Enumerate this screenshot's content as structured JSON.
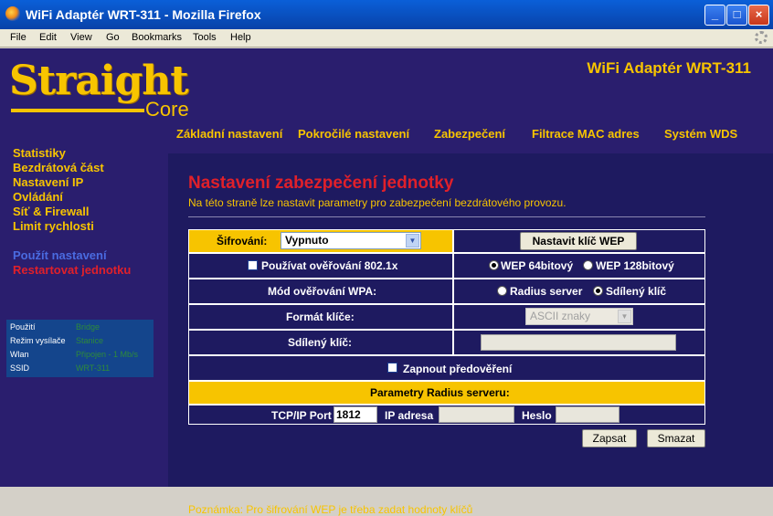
{
  "window": {
    "title": "WiFi Adaptér WRT-311 - Mozilla Firefox"
  },
  "menu": {
    "items": [
      "File",
      "Edit",
      "View",
      "Go",
      "Bookmarks",
      "Tools",
      "Help"
    ]
  },
  "logo": {
    "main": "Straight",
    "sub": "Core"
  },
  "product_name": "WiFi Adaptér WRT-311",
  "top_nav": [
    "Základní nastavení",
    "Pokročilé nastavení",
    "Zabezpečení",
    "Filtrace MAC adres",
    "Systém WDS"
  ],
  "side_nav": {
    "items": [
      "Statistiky",
      "Bezdrátová část",
      "Nastavení IP",
      "Ovládání",
      "Síť & Firewall",
      "Limit rychlosti"
    ],
    "apply": "Použít nastavení",
    "restart": "Restartovat jednotku"
  },
  "status": {
    "rows": [
      {
        "k": "Použití",
        "v": "Bridge"
      },
      {
        "k": "Režim vysílače",
        "v": "Stanice"
      },
      {
        "k": "Wlan",
        "v": "Připojen - 1 Mb/s"
      },
      {
        "k": "SSID",
        "v": "WRT-311"
      }
    ]
  },
  "content": {
    "title": "Nastavení zabezpečení jednotky",
    "subtitle": "Na této straně lze nastavit parametry pro zabezpečení bezdrátového provozu.",
    "encryption_label": "Šifrování:",
    "encryption_value": "Vypnuto",
    "set_wep_button": "Nastavit klíč WEP",
    "use_8021x": "Používat ověřování 802.1x",
    "wep64": "WEP 64bitový",
    "wep128": "WEP 128bitový",
    "wpa_mode_label": "Mód ověřování WPA:",
    "radius_server": "Radius server",
    "shared_key_opt": "Sdílený klíč",
    "key_format_label": "Formát klíče:",
    "key_format_value": "ASCII znaky",
    "shared_key_label": "Sdílený klíč:",
    "preauth": "Zapnout předověření",
    "radius_header": "Parametry Radius serveru:",
    "tcpip_port_label": "TCP/IP Port",
    "tcpip_port_value": "1812",
    "ip_label": "IP adresa",
    "password_label": "Heslo",
    "save_button": "Zapsat",
    "delete_button": "Smazat",
    "note": "Poznámka: Pro šifrování WEP je třeba zadat hodnoty klíčů"
  },
  "colors": {
    "page_bg": "#2a1e6e",
    "accent": "#f7c400",
    "title_red": "#e0202a",
    "link_blue": "#4a6be0"
  }
}
